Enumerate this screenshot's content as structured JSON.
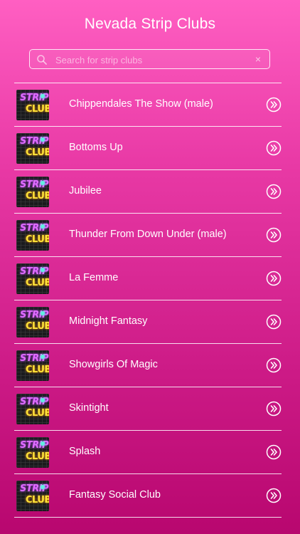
{
  "header": {
    "title": "Nevada Strip Clubs"
  },
  "search": {
    "placeholder": "Search for strip clubs",
    "value": "",
    "clear_symbol": "×"
  },
  "thumbnail": {
    "line1": "STRIP",
    "line2": "CLUBS"
  },
  "clubs": [
    {
      "name": "Chippendales The Show (male)"
    },
    {
      "name": "Bottoms Up"
    },
    {
      "name": "Jubilee"
    },
    {
      "name": "Thunder From Down Under (male)"
    },
    {
      "name": "La Femme"
    },
    {
      "name": "Midnight Fantasy"
    },
    {
      "name": "Showgirls Of Magic"
    },
    {
      "name": "Skintight"
    },
    {
      "name": "Splash"
    },
    {
      "name": "Fantasy Social Club"
    }
  ],
  "icons": {
    "search": "search-icon",
    "row_action": "double-chevron-right-icon",
    "clear": "clear-icon"
  },
  "colors": {
    "gradient_top": "#ff5fc2",
    "gradient_bottom": "#b8076f"
  }
}
